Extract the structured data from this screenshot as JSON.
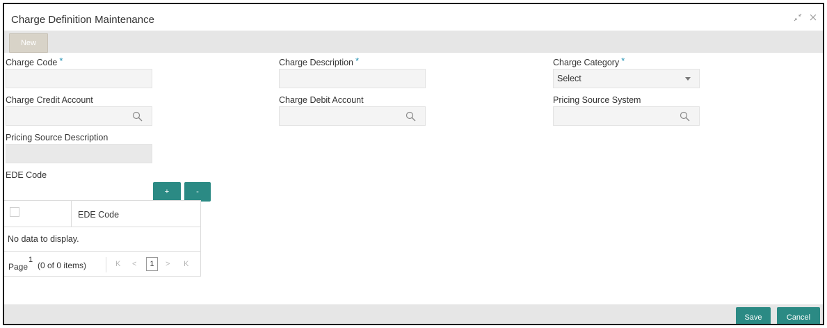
{
  "window": {
    "title": "Charge Definition Maintenance",
    "expand_icon": "expand-icon",
    "close_icon": "close-icon"
  },
  "toolbar": {
    "new_label": "New"
  },
  "fields": {
    "charge_code": {
      "label": "Charge Code",
      "required": "*",
      "value": ""
    },
    "charge_description": {
      "label": "Charge Description",
      "required": "*",
      "value": ""
    },
    "charge_category": {
      "label": "Charge Category",
      "required": "*",
      "value": "Select"
    },
    "charge_credit_account": {
      "label": "Charge Credit Account",
      "value": ""
    },
    "charge_debit_account": {
      "label": "Charge Debit Account",
      "value": ""
    },
    "pricing_source_system": {
      "label": "Pricing Source System",
      "value": ""
    },
    "pricing_source_description": {
      "label": "Pricing Source Description",
      "value": ""
    }
  },
  "ede": {
    "label": "EDE Code",
    "add_label": "+",
    "remove_label": "-",
    "table": {
      "columns": [
        "EDE Code"
      ],
      "empty_text": "No data to display.",
      "pager": {
        "page_label": "Page",
        "page_number": "1",
        "items_text": "(0 of 0 items)",
        "first": "K",
        "prev": "<",
        "current": "1",
        "next": ">",
        "last": "K"
      }
    }
  },
  "footer": {
    "save_label": "Save",
    "cancel_label": "Cancel"
  },
  "colors": {
    "accent": "#2b8a84",
    "required": "#1f8fb2",
    "bar": "#e6e6e6"
  }
}
